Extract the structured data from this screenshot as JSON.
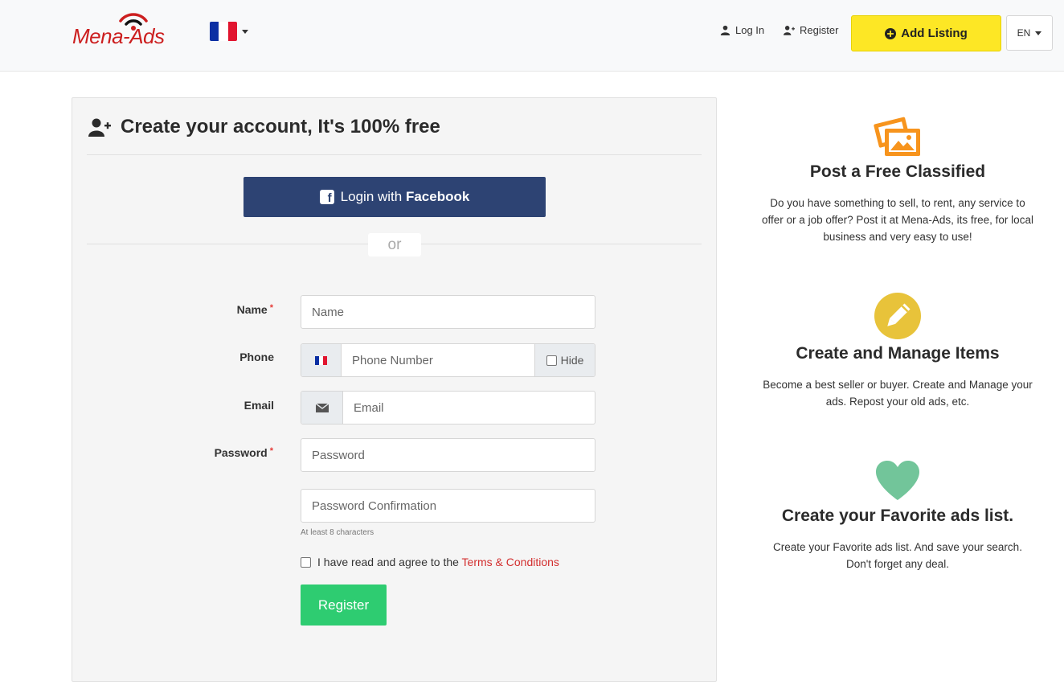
{
  "header": {
    "logo_text": "Mena-Ads",
    "login_label": "Log In",
    "register_label": "Register",
    "add_listing_label": "Add Listing",
    "lang_label": "EN",
    "flag_colors": [
      "#0b2fa3",
      "#ffffff",
      "#e1152f"
    ]
  },
  "form": {
    "title": "Create your account, It's 100% free",
    "facebook_prefix": "Login with ",
    "facebook_brand": "Facebook",
    "or_label": "or",
    "name_label": "Name",
    "name_placeholder": "Name",
    "phone_label": "Phone",
    "phone_placeholder": "Phone Number",
    "hide_label": "Hide",
    "email_label": "Email",
    "email_placeholder": "Email",
    "password_label": "Password",
    "password_placeholder": "Password",
    "password_confirm_placeholder": "Password Confirmation",
    "password_hint": "At least 8 characters",
    "agree_text": "I have read and agree to the ",
    "terms_link": "Terms & Conditions",
    "register_button": "Register",
    "required_mark": "*"
  },
  "features": [
    {
      "icon": "images-icon",
      "title": "Post a Free Classified",
      "text": "Do you have something to sell, to rent, any service to offer or a job offer? Post it at Mena-Ads, its free, for local business and very easy to use!"
    },
    {
      "icon": "pencil-icon",
      "title": "Create and Manage Items",
      "text": "Become a best seller or buyer. Create and Manage your ads. Repost your old ads, etc."
    },
    {
      "icon": "heart-icon",
      "title": "Create your Favorite ads list.",
      "text": "Create your Favorite ads list. And save your search. Don't forget any deal."
    }
  ],
  "colors": {
    "accent_yellow": "#fde725",
    "facebook_blue": "#2d4373",
    "register_green": "#2ecc71",
    "terms_red": "#d32f2f",
    "images_orange": "#f7941d",
    "pencil_yellow": "#e8c33a",
    "heart_green": "#72c59a"
  }
}
